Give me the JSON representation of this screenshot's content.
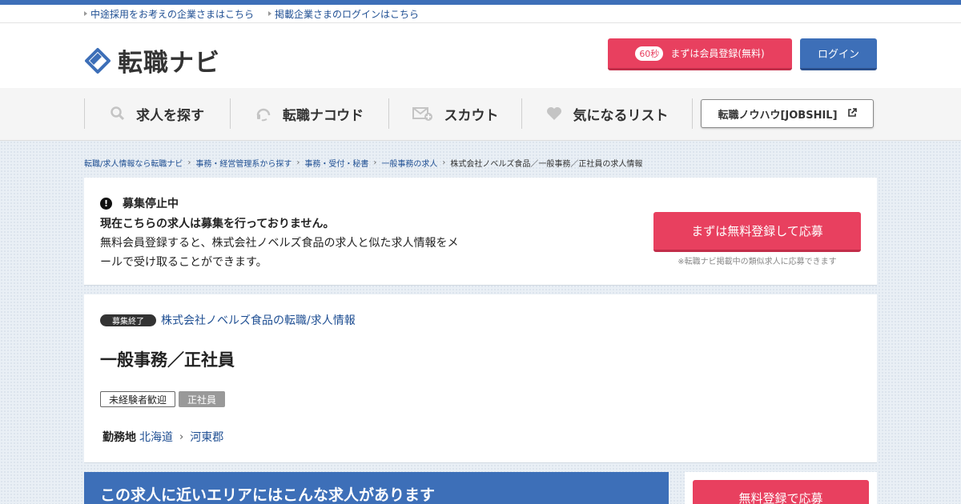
{
  "top_links": [
    "中途採用をお考えの企業さまはこちら",
    "掲載企業さまのログインはこちら"
  ],
  "header": {
    "logo_text": "転職ナビ",
    "register_badge": "60秒",
    "register_label": "まずは会員登録(無料)",
    "login_label": "ログイン"
  },
  "nav": {
    "items": [
      {
        "label": "求人を探す",
        "icon": "search-icon"
      },
      {
        "label": "転職ナコウド",
        "icon": "headset-icon"
      },
      {
        "label": "スカウト",
        "icon": "mail-plus-icon"
      },
      {
        "label": "気になるリスト",
        "icon": "heart-icon"
      }
    ],
    "jobshil_label": "転職ノウハウ[JOBSHIL]"
  },
  "breadcrumb": [
    "転職/求人情報なら転職ナビ",
    "事務・経営管理系から探す",
    "事務・受付・秘書",
    "一般事務の求人",
    "株式会社ノベルズ食品／一般事務／正社員の求人情報"
  ],
  "notice": {
    "title": "募集停止中",
    "line1": "現在こちらの求人は募集を行っておりません。",
    "line2": "無料会員登録すると、株式会社ノベルズ食品の求人と似た求人情報をメールで受け取ることができます。",
    "apply_label": "まずは無料登録して応募",
    "apply_note": "※転職ナビ掲載中の類似求人に応募できます"
  },
  "job": {
    "status_badge": "募集終了",
    "company_link": "株式会社ノベルズ食品の転職/求人情報",
    "title": "一般事務／正社員",
    "tags": [
      "未経験者歓迎",
      "正社員"
    ],
    "location_label": "勤務地",
    "prefecture": "北海道",
    "district": "河東郡"
  },
  "nearby_heading": "この求人に近いエリアにはこんな求人があります",
  "side_button_label": "無料登録で応募",
  "colors": {
    "brand_blue": "#3d6fb8",
    "cta_pink": "#e8405f",
    "link_blue": "#1f4f93"
  }
}
